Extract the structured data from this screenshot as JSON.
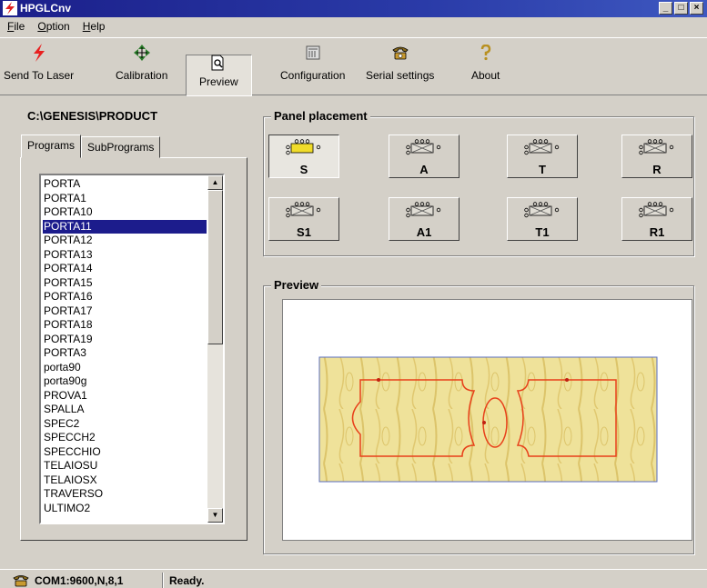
{
  "window": {
    "title": "HPGLCnv",
    "minimize": "_",
    "maximize": "□",
    "close": "×"
  },
  "menu": [
    {
      "label": "File",
      "hotkey": "F",
      "rest": "ile"
    },
    {
      "label": "Option",
      "hotkey": "O",
      "rest": "ption"
    },
    {
      "label": "Help",
      "hotkey": "H",
      "rest": "elp"
    }
  ],
  "toolbar": {
    "send_to_laser": "Send To Laser",
    "calibration": "Calibration",
    "preview": "Preview",
    "configuration": "Configuration",
    "serial_settings": "Serial settings",
    "about": "About"
  },
  "path": "C:\\GENESIS\\PRODUCT",
  "tabs": {
    "programs": "Programs",
    "subprograms": "SubPrograms"
  },
  "programs": [
    "PORTA",
    "PORTA1",
    "PORTA10",
    "PORTA11",
    "PORTA12",
    "PORTA13",
    "PORTA14",
    "PORTA15",
    "PORTA16",
    "PORTA17",
    "PORTA18",
    "PORTA19",
    "PORTA3",
    "porta90",
    "porta90g",
    "PROVA1",
    "SPALLA",
    "SPEC2",
    "SPECCH2",
    "SPECCHIO",
    "TELAIOSU",
    "TELAIOSX",
    "TRAVERSO",
    "ULTIMO2"
  ],
  "selected_program": "PORTA11",
  "panel_placement": {
    "title": "Panel placement",
    "buttons": [
      {
        "label": "S"
      },
      {
        "label": "A"
      },
      {
        "label": "T"
      },
      {
        "label": "R"
      },
      {
        "label": "S1"
      },
      {
        "label": "A1"
      },
      {
        "label": "T1"
      },
      {
        "label": "R1"
      }
    ],
    "selected": "S"
  },
  "preview": {
    "title": "Preview"
  },
  "status": {
    "port": "COM1:9600,N,8,1",
    "message": "Ready."
  },
  "colors": {
    "titlebar": "#1b1f8a",
    "selection": "#1c1c8c",
    "cut_path": "#e8401a",
    "wood": "#ecdc86",
    "panel_active": "#f0dc2a"
  }
}
